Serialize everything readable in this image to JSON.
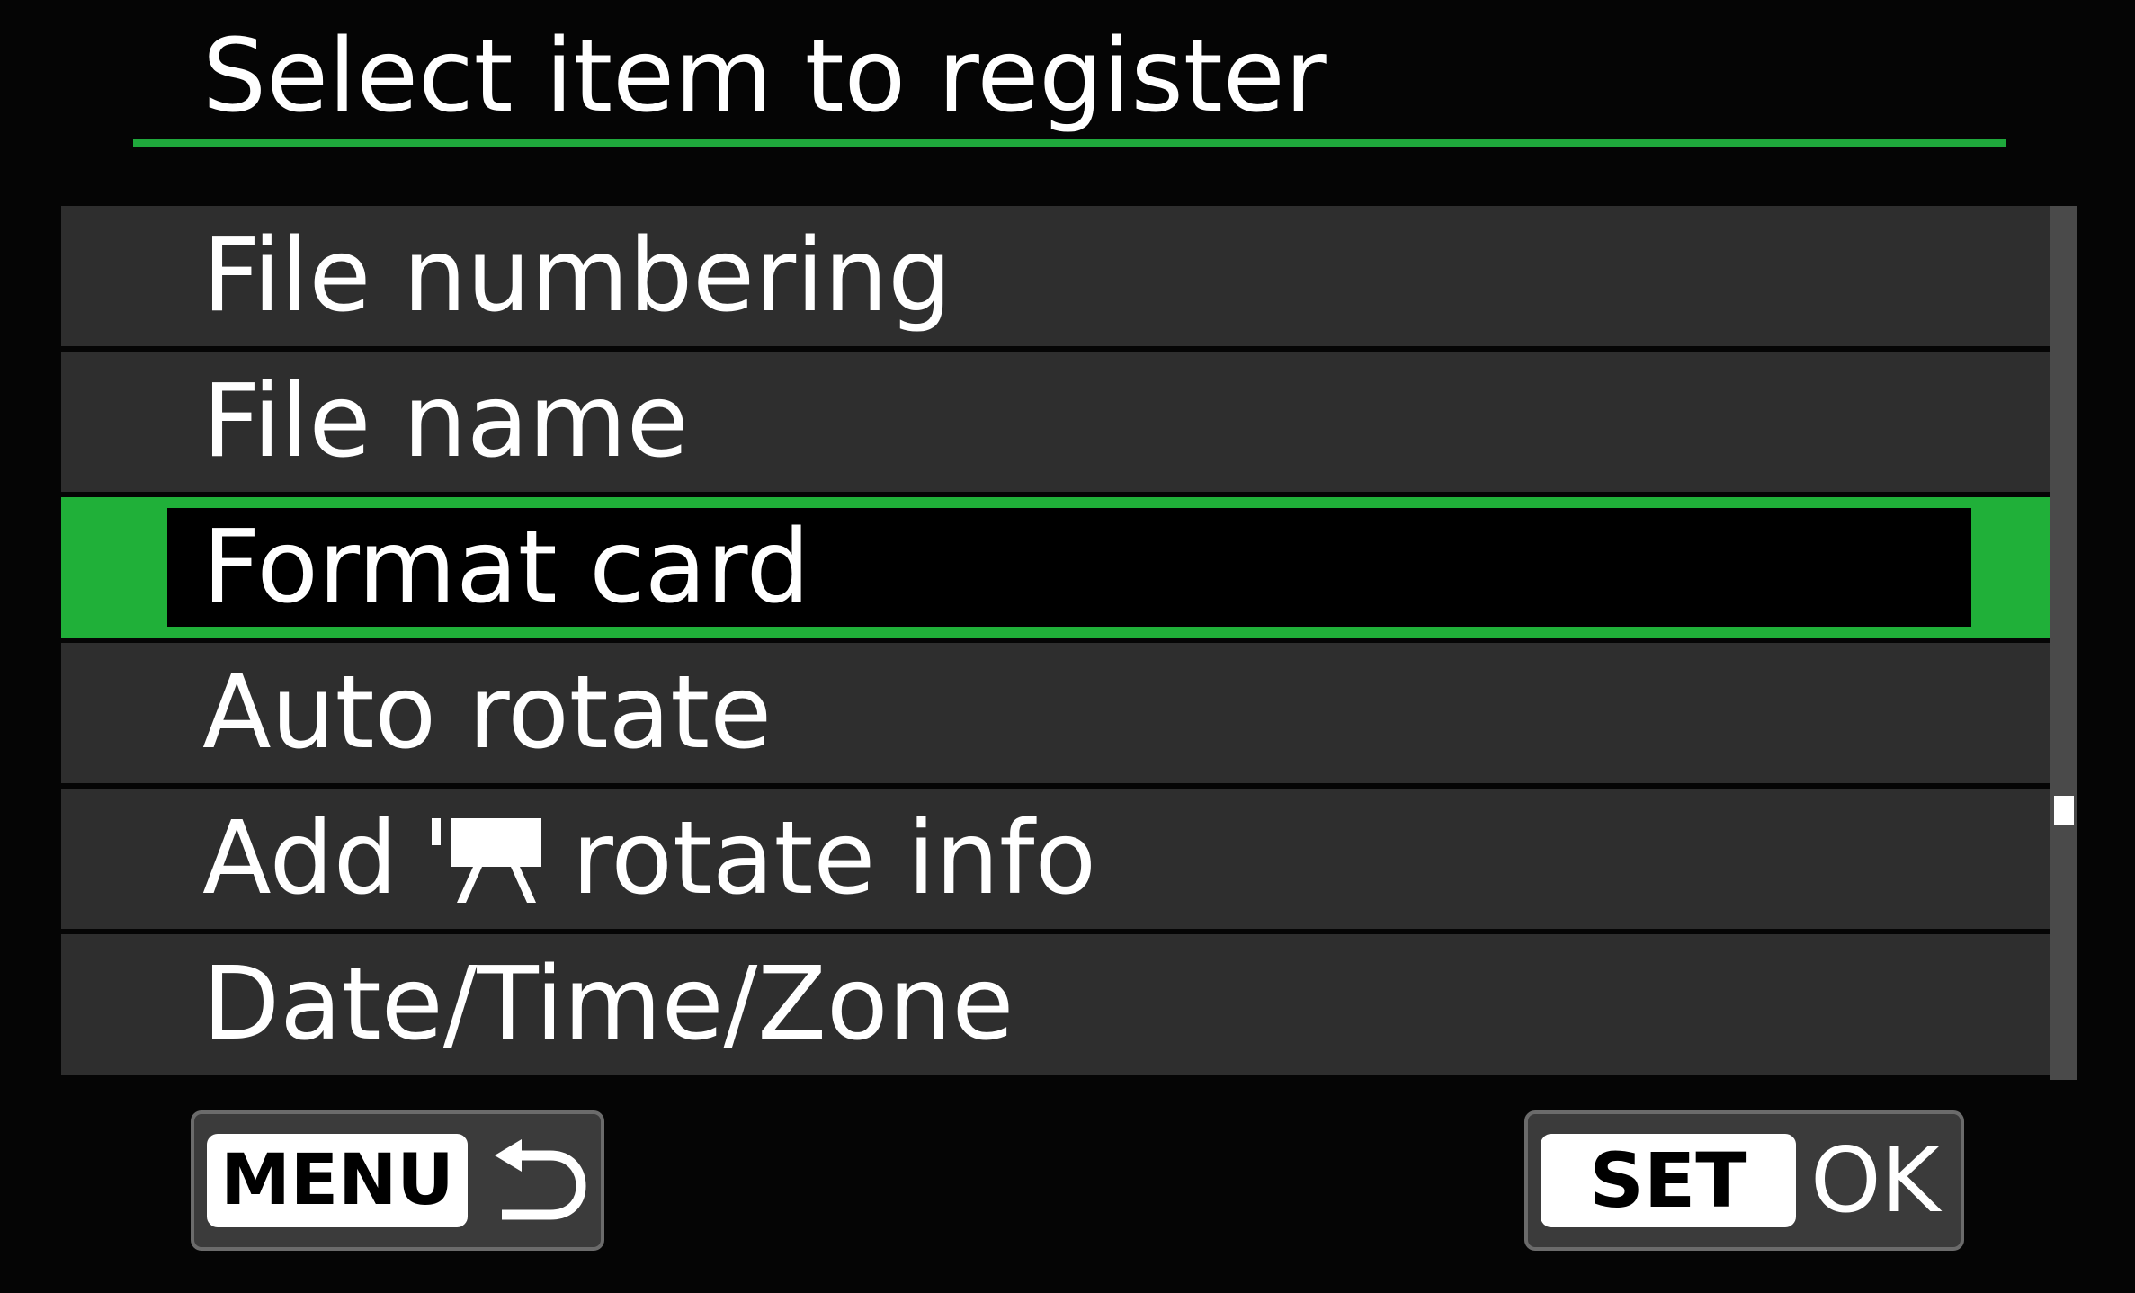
{
  "screen": {
    "title": "Select item to register",
    "accent_color": "#20b039"
  },
  "menu": {
    "selected_index": 2,
    "items": [
      {
        "label": "File numbering"
      },
      {
        "label": "File name"
      },
      {
        "label": "Format card"
      },
      {
        "label": "Auto rotate"
      },
      {
        "label_prefix": "Add",
        "icon": "movie-camera-icon",
        "label_suffix": "rotate info"
      },
      {
        "label": "Date/Time/Zone"
      }
    ]
  },
  "scrollbar": {
    "position_fraction": 0.68
  },
  "footer": {
    "menu_key": "MENU",
    "menu_icon": "return-arrow-icon",
    "set_key": "SET",
    "set_label": "OK"
  }
}
